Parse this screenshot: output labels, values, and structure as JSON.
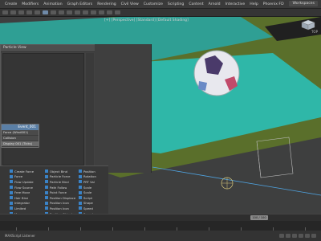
{
  "menubar": {
    "items": [
      "Create",
      "Modifiers",
      "Animation",
      "Graph Editors",
      "Rendering",
      "Civil View",
      "Customize",
      "Scripting",
      "Content",
      "Arnold",
      "Interactive",
      "Help",
      "Phoenix FD",
      "Deadline"
    ],
    "workspace": "Workspaces"
  },
  "viewport": {
    "label": "[+] [Perspective] [Standard] [Default Shading]",
    "navcube_label": "TOP"
  },
  "particle_view": {
    "title": "Particle View",
    "node": {
      "header": "Event_001",
      "rows": [
        "Force (Wind001)",
        "Collision",
        "Display 001 (Ticks)"
      ]
    },
    "status": "Display 001 Ticks"
  },
  "depot": {
    "columns": [
      [
        "Create Force",
        "Force",
        "Flow Update",
        "Flow Source",
        "Free Move",
        "Hair Bind",
        "Integrator",
        "Limited",
        "Mass"
      ],
      [
        "Object Bind",
        "Particle Force",
        "Particle Bind",
        "Path Follow",
        "Point Force",
        "Position Displace",
        "Position Icon",
        "Position Icon",
        "Position Object"
      ],
      [
        "Position",
        "Rotation",
        "PRT Val",
        "Scale",
        "Scale",
        "Script",
        "Shape",
        "Speed",
        "Speed"
      ]
    ]
  },
  "timeline": {
    "frame": "100 / 100"
  },
  "status": {
    "text": "MAXScript Listener"
  },
  "colors": {
    "grass": "#2fb7a8",
    "ground": "#5a6f2b",
    "node_header": "#5a7fa6",
    "operator_icon": "#3a83c7"
  }
}
